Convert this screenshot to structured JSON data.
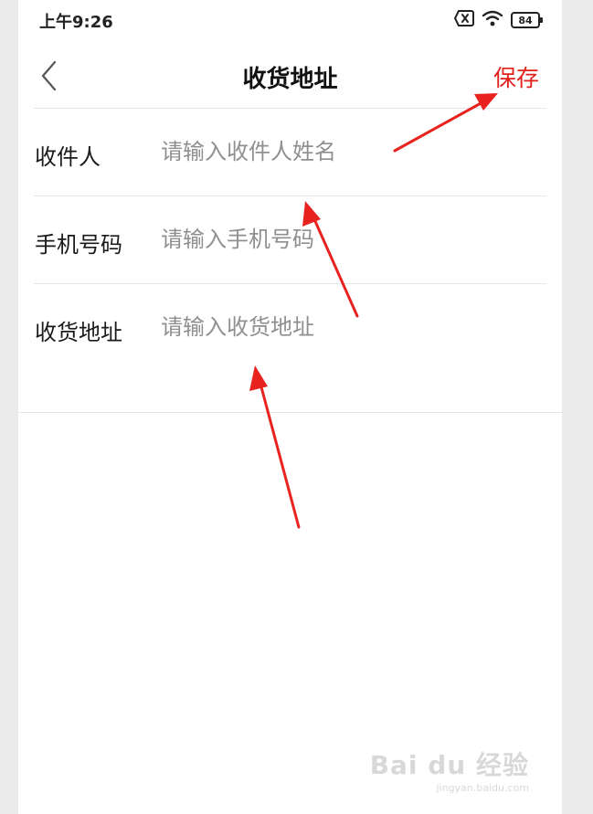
{
  "status_bar": {
    "time": "上午9:26",
    "battery": "84",
    "icons": [
      "no-sim-icon",
      "wifi-icon",
      "battery-icon"
    ]
  },
  "nav": {
    "title": "收货地址",
    "save_label": "保存",
    "back_icon": "chevron-left-icon"
  },
  "form": {
    "rows": [
      {
        "label": "收件人",
        "placeholder": "请输入收件人姓名",
        "value": ""
      },
      {
        "label": "手机号码",
        "placeholder": "请输入手机号码",
        "value": ""
      },
      {
        "label": "收货地址",
        "placeholder": "请输入收货地址",
        "value": ""
      }
    ]
  },
  "annotations": {
    "arrow_color": "#e8231f",
    "arrows": [
      "arrow-to-save",
      "arrow-to-name",
      "arrow-to-address"
    ]
  },
  "watermark": {
    "main": "Bai du 经验",
    "sub": "jingyan.baidu.com"
  },
  "colors": {
    "accent": "#e0201b",
    "placeholder": "#8f8f8f",
    "divider": "#e6e6e6"
  }
}
